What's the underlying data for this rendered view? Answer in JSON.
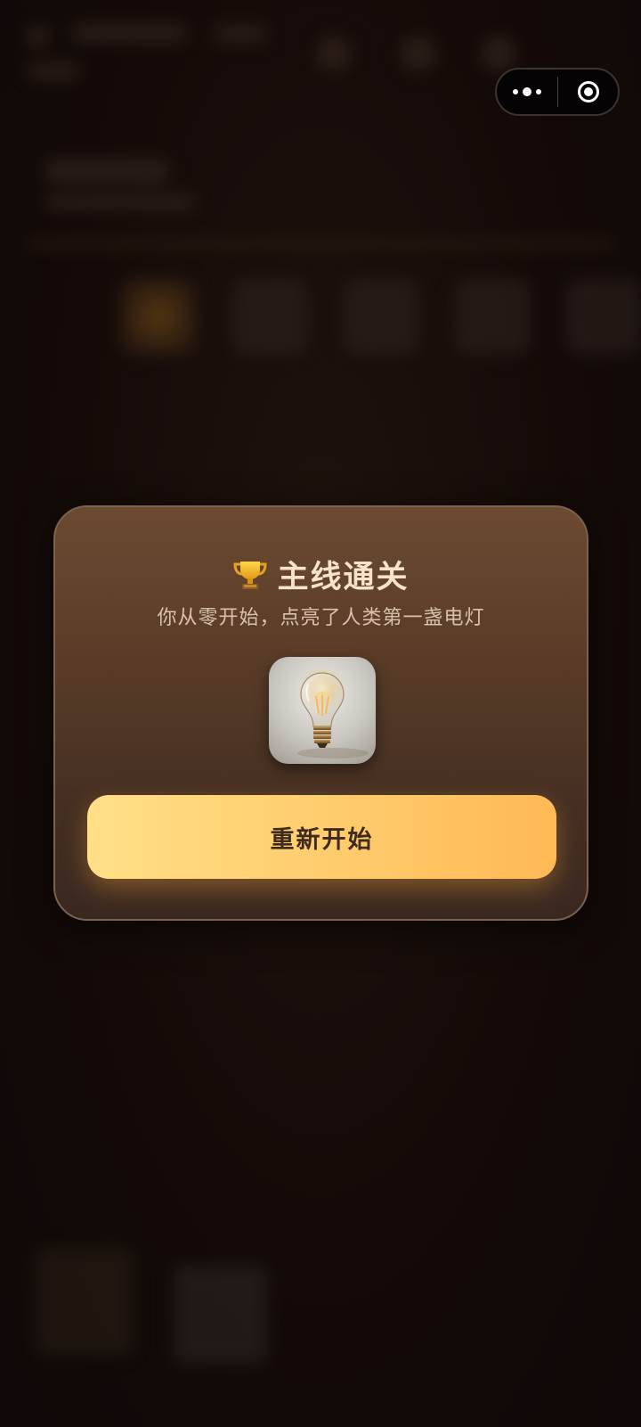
{
  "modal": {
    "title": "主线通关",
    "subtitle": "你从零开始，点亮了人类第一盏电灯",
    "restart_label": "重新开始",
    "icon": "trophy-icon",
    "image": "light-bulb"
  },
  "capsule": {
    "menu_icon": "more-dots-icon",
    "close_icon": "target-circle-icon"
  },
  "colors": {
    "accent": "#ffcd6e",
    "card": "#5a3d28",
    "title_text": "#f7e3c8"
  }
}
